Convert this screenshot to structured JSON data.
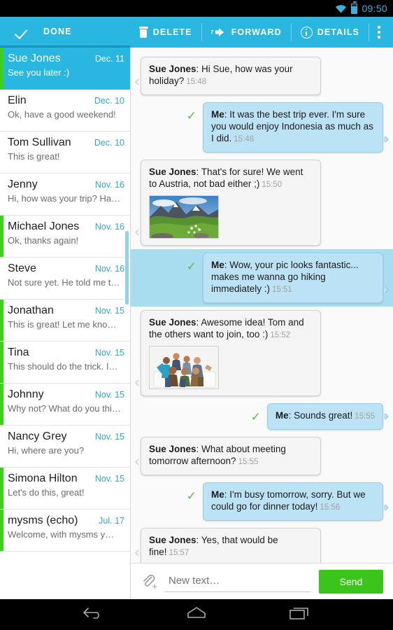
{
  "status_bar": {
    "clock": "09:50",
    "wifi_icon": "wifi-icon",
    "battery_icon": "battery-icon"
  },
  "action_bar": {
    "done_label": "DONE",
    "delete_label": "DELETE",
    "forward_label": "FORWARD",
    "details_label": "DETAILS",
    "overflow_icon": "more-vertical-icon",
    "accent_color": "#29b6e0"
  },
  "sidebar": {
    "scroll_thumb_color": "#8fd4ef",
    "unread_marker_color": "#3ed11b",
    "conversations": [
      {
        "name": "Sue Jones",
        "date": "Dec. 11",
        "preview": "See you later :)",
        "selected": true,
        "unread": true
      },
      {
        "name": "Elin",
        "date": "Dec. 10",
        "preview": "Ok, have a good weekend!",
        "selected": false,
        "unread": false
      },
      {
        "name": "Tom Sullivan",
        "date": "Dec. 10",
        "preview": "This is great!",
        "selected": false,
        "unread": false
      },
      {
        "name": "Jenny",
        "date": "Nov. 16",
        "preview": "Hi, how was your trip? Ha…",
        "selected": false,
        "unread": false
      },
      {
        "name": "Michael Jones",
        "date": "Nov. 16",
        "preview": "Ok, thanks again!",
        "selected": false,
        "unread": true
      },
      {
        "name": "Steve",
        "date": "Nov. 16",
        "preview": "Not sure yet. He told me t…",
        "selected": false,
        "unread": false
      },
      {
        "name": "Jonathan",
        "date": "Nov. 15",
        "preview": "This is great! Let me kno…",
        "selected": false,
        "unread": true
      },
      {
        "name": "Tina",
        "date": "Nov. 15",
        "preview": "This should do the trick. I…",
        "selected": false,
        "unread": true
      },
      {
        "name": "Johnny",
        "date": "Nov. 15",
        "preview": "Why not? What do you thi…",
        "selected": false,
        "unread": true
      },
      {
        "name": "Nancy Grey",
        "date": "Nov. 15",
        "preview": "Hi, where are you?",
        "selected": false,
        "unread": false
      },
      {
        "name": "Simona Hilton",
        "date": "Nov. 15",
        "preview": "Let's do this, great!",
        "selected": false,
        "unread": true
      },
      {
        "name": "mysms (echo)",
        "date": "Jul. 17",
        "preview": "Welcome,  with mysms y…",
        "selected": false,
        "unread": true
      }
    ]
  },
  "chat": {
    "selected_row_color": "#a8ddf0",
    "messages": [
      {
        "sender": "Sue Jones",
        "text": "Hi Sue, how was your holiday?",
        "time": "15:48",
        "direction": "in",
        "image": null,
        "selected": false,
        "sent_check": false
      },
      {
        "sender": "Me",
        "text": "It was the best trip ever. I'm sure you would enjoy Indonesia as much as I did.",
        "time": "15:48",
        "direction": "out",
        "image": null,
        "selected": false,
        "sent_check": true
      },
      {
        "sender": "Sue Jones",
        "text": "That's for sure! We went to Austria, not bad either ;)",
        "time": "15:50",
        "direction": "in",
        "image": "mountain-landscape-photo",
        "selected": false,
        "sent_check": false
      },
      {
        "sender": "Me",
        "text": "Wow, your pic looks fantastic... makes me wanna go hiking immediately :)",
        "time": "15:51",
        "direction": "out",
        "image": null,
        "selected": true,
        "sent_check": true
      },
      {
        "sender": "Sue Jones",
        "text": "Awesome idea! Tom and the others want to join, too :)",
        "time": "15:52",
        "direction": "in",
        "image": "group-of-friends-photo",
        "selected": false,
        "sent_check": false
      },
      {
        "sender": "Me",
        "text": "Sounds great!",
        "time": "15:55",
        "direction": "out",
        "image": null,
        "selected": false,
        "sent_check": true
      },
      {
        "sender": "Sue Jones",
        "text": "What about meeting tomorrow afternoon?",
        "time": "15:55",
        "direction": "in",
        "image": null,
        "selected": false,
        "sent_check": false
      },
      {
        "sender": "Me",
        "text": "I'm busy tomorrow, sorry. But we could go for dinner today!",
        "time": "15:56",
        "direction": "out",
        "image": null,
        "selected": false,
        "sent_check": true
      },
      {
        "sender": "Sue Jones",
        "text": "Yes, that would be fine!",
        "time": "15:57",
        "direction": "in",
        "image": null,
        "selected": false,
        "sent_check": false
      }
    ]
  },
  "composer": {
    "attach_icon": "paperclip-add-icon",
    "input_value": "",
    "input_placeholder": "New text…",
    "send_label": "Send",
    "send_color": "#3bc41b"
  },
  "nav_bar": {
    "back_icon": "back-icon",
    "home_icon": "home-icon",
    "recents_icon": "recent-apps-icon"
  }
}
